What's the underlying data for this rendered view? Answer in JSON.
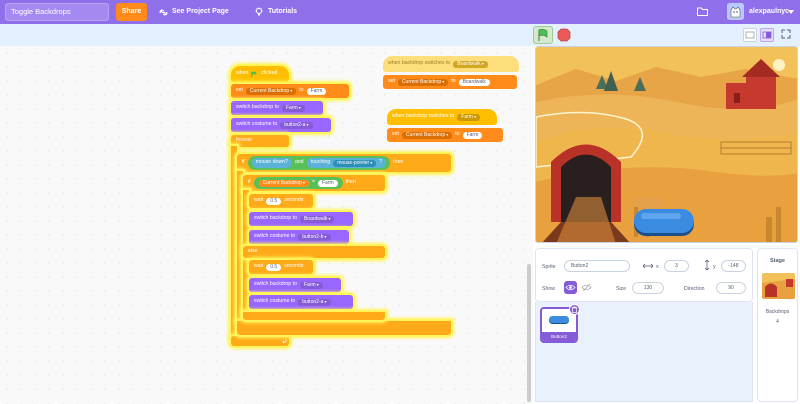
{
  "menubar": {
    "project_title": "Toggle Backdrops",
    "share_label": "Share",
    "see_project_label": "See Project Page",
    "tutorials_label": "Tutorials",
    "username": "alexpaulnyc",
    "folder_icon": "folder-icon",
    "avatar_icon": "cat-avatar-icon"
  },
  "controls": {
    "green_flag_icon": "green-flag-icon",
    "stop_icon": "stop-sign-icon",
    "small_stage_icon": "small-stage-icon",
    "large_stage_icon": "large-stage-icon",
    "fullscreen_icon": "fullscreen-icon"
  },
  "script_main": {
    "when_flag_clicked": [
      "when",
      "clicked"
    ],
    "set_var": {
      "set": "set",
      "var": "Current Backdrop",
      "to": "to",
      "value": "Farm"
    },
    "switch_backdrop_1": {
      "label": "switch backdrop to",
      "value": "Farm"
    },
    "switch_costume_1": {
      "label": "switch costume to",
      "value": "button2-a"
    },
    "forever": "forever",
    "if_outer": {
      "if": "if",
      "then": "then"
    },
    "mouse_down": "mouse down?",
    "and": "and",
    "touching": {
      "label": "touching",
      "value": "mouse-pointer",
      "q": "?"
    },
    "if_inner": {
      "if": "if",
      "then": "then"
    },
    "equals": {
      "var": "Current Backdrop",
      "op": "=",
      "value": "Farm"
    },
    "wait_1": {
      "wait": "wait",
      "value": "0.5",
      "unit": "seconds"
    },
    "switch_backdrop_2": {
      "label": "switch backdrop to",
      "value": "Boardwalk"
    },
    "switch_costume_2": {
      "label": "switch costume to",
      "value": "button2-b"
    },
    "else": "else",
    "wait_2": {
      "wait": "wait",
      "value": "0.5",
      "unit": "seconds"
    },
    "switch_backdrop_3": {
      "label": "switch backdrop to",
      "value": "Farm"
    },
    "switch_costume_3": {
      "label": "switch costume to",
      "value": "button2-a"
    }
  },
  "script_boardwalk": {
    "hat": {
      "label": "when backdrop switches to",
      "value": "Boardwalk"
    },
    "set_var": {
      "set": "set",
      "var": "Current Backdrop",
      "to": "to",
      "value": "Boardwalk"
    }
  },
  "script_farm": {
    "hat": {
      "label": "when backdrop switches to",
      "value": "Farm"
    },
    "set_var": {
      "set": "set",
      "var": "Current Backdrop",
      "to": "to",
      "value": "Farm"
    }
  },
  "sprite_info": {
    "sprite_label": "Sprite",
    "sprite_name": "Button2",
    "x_label": "x",
    "x_value": "3",
    "y_label": "y",
    "y_value": "-148",
    "show_label": "Show",
    "size_label": "Size",
    "size_value": "130",
    "direction_label": "Direction",
    "direction_value": "90"
  },
  "sprites": [
    {
      "name": "Button2"
    }
  ],
  "stage_pane": {
    "title": "Stage",
    "backdrops_label": "Backdrops",
    "backdrops_count": "4"
  },
  "colors": {
    "menu": "#8F6FEA",
    "share": "#FF8C1A",
    "events": "#FFBF00",
    "control": "#FFAB19",
    "looks": "#9966FF",
    "variables": "#FF8C1A",
    "sensing": "#5CB1D6",
    "operators": "#59C059"
  }
}
